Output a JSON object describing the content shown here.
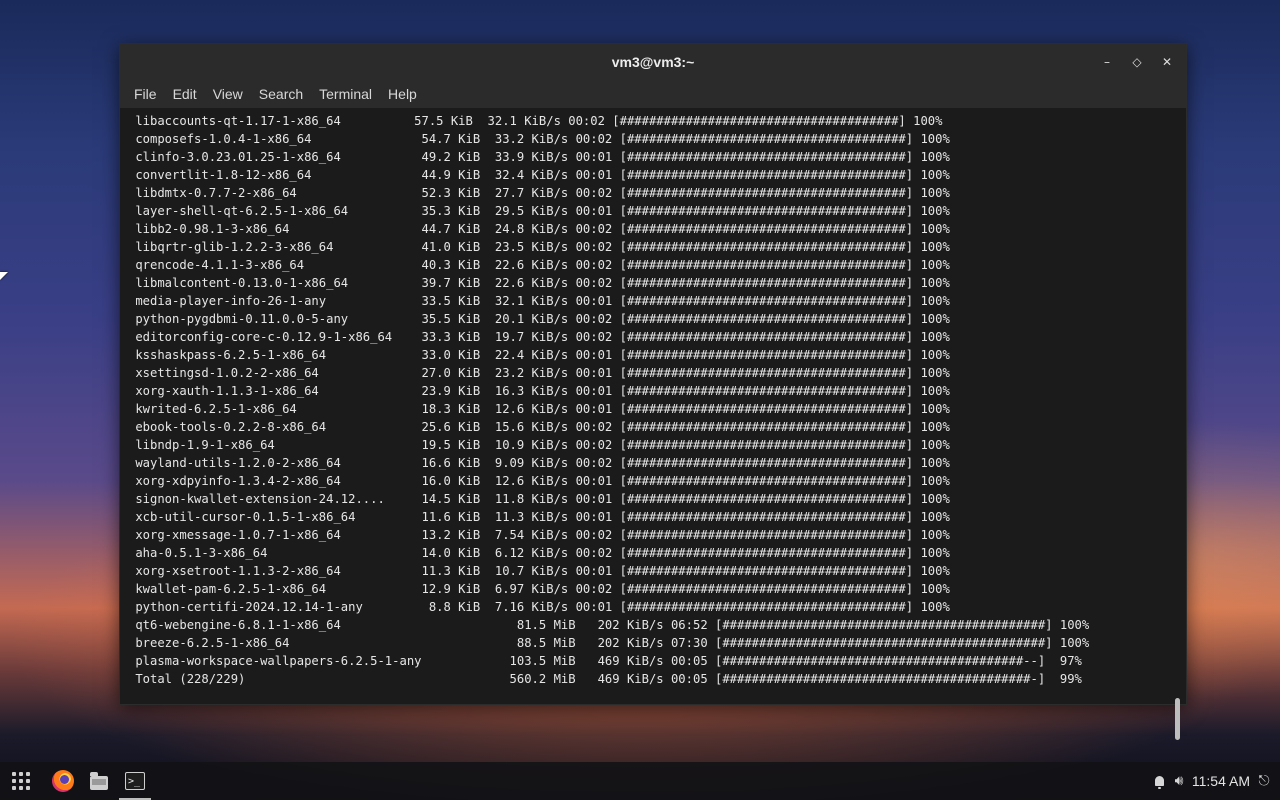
{
  "window": {
    "title": "vm3@vm3:~",
    "controls": {
      "minimize": "–",
      "maximize": "◇",
      "close": "✕"
    }
  },
  "menu": [
    "File",
    "Edit",
    "View",
    "Search",
    "Terminal",
    "Help"
  ],
  "terminal": {
    "lines": [
      " libaccounts-qt-1.17-1-x86_64          57.5 KiB  32.1 KiB/s 00:02 [######################################] 100%",
      " composefs-1.0.4-1-x86_64               54.7 KiB  33.2 KiB/s 00:02 [######################################] 100%",
      " clinfo-3.0.23.01.25-1-x86_64           49.2 KiB  33.9 KiB/s 00:01 [######################################] 100%",
      " convertlit-1.8-12-x86_64               44.9 KiB  32.4 KiB/s 00:01 [######################################] 100%",
      " libdmtx-0.7.7-2-x86_64                 52.3 KiB  27.7 KiB/s 00:02 [######################################] 100%",
      " layer-shell-qt-6.2.5-1-x86_64          35.3 KiB  29.5 KiB/s 00:01 [######################################] 100%",
      " libb2-0.98.1-3-x86_64                  44.7 KiB  24.8 KiB/s 00:02 [######################################] 100%",
      " libqrtr-glib-1.2.2-3-x86_64            41.0 KiB  23.5 KiB/s 00:02 [######################################] 100%",
      " qrencode-4.1.1-3-x86_64                40.3 KiB  22.6 KiB/s 00:02 [######################################] 100%",
      " libmalcontent-0.13.0-1-x86_64          39.7 KiB  22.6 KiB/s 00:02 [######################################] 100%",
      " media-player-info-26-1-any             33.5 KiB  32.1 KiB/s 00:01 [######################################] 100%",
      " python-pygdbmi-0.11.0.0-5-any          35.5 KiB  20.1 KiB/s 00:02 [######################################] 100%",
      " editorconfig-core-c-0.12.9-1-x86_64    33.3 KiB  19.7 KiB/s 00:02 [######################################] 100%",
      " ksshaskpass-6.2.5-1-x86_64             33.0 KiB  22.4 KiB/s 00:01 [######################################] 100%",
      " xsettingsd-1.0.2-2-x86_64              27.0 KiB  23.2 KiB/s 00:01 [######################################] 100%",
      " xorg-xauth-1.1.3-1-x86_64              23.9 KiB  16.3 KiB/s 00:01 [######################################] 100%",
      " kwrited-6.2.5-1-x86_64                 18.3 KiB  12.6 KiB/s 00:01 [######################################] 100%",
      " ebook-tools-0.2.2-8-x86_64             25.6 KiB  15.6 KiB/s 00:02 [######################################] 100%",
      " libndp-1.9-1-x86_64                    19.5 KiB  10.9 KiB/s 00:02 [######################################] 100%",
      " wayland-utils-1.2.0-2-x86_64           16.6 KiB  9.09 KiB/s 00:02 [######################################] 100%",
      " xorg-xdpyinfo-1.3.4-2-x86_64           16.0 KiB  12.6 KiB/s 00:01 [######################################] 100%",
      " signon-kwallet-extension-24.12....     14.5 KiB  11.8 KiB/s 00:01 [######################################] 100%",
      " xcb-util-cursor-0.1.5-1-x86_64         11.6 KiB  11.3 KiB/s 00:01 [######################################] 100%",
      " xorg-xmessage-1.0.7-1-x86_64           13.2 KiB  7.54 KiB/s 00:02 [######################################] 100%",
      " aha-0.5.1-3-x86_64                     14.0 KiB  6.12 KiB/s 00:02 [######################################] 100%",
      " xorg-xsetroot-1.1.3-2-x86_64           11.3 KiB  10.7 KiB/s 00:01 [######################################] 100%",
      " kwallet-pam-6.2.5-1-x86_64             12.9 KiB  6.97 KiB/s 00:02 [######################################] 100%",
      " python-certifi-2024.12.14-1-any         8.8 KiB  7.16 KiB/s 00:01 [######################################] 100%",
      " qt6-webengine-6.8.1-1-x86_64                        81.5 MiB   202 KiB/s 06:52 [############################################] 100%",
      " breeze-6.2.5-1-x86_64                               88.5 MiB   202 KiB/s 07:30 [############################################] 100%",
      " plasma-workspace-wallpapers-6.2.5-1-any            103.5 MiB   469 KiB/s 00:05 [#########################################--]  97%",
      " Total (228/229)                                    560.2 MiB   469 KiB/s 00:05 [##########################################-]  99%"
    ]
  },
  "taskbar": {
    "clock": "11:54 AM",
    "logout_glyph": "⎋"
  }
}
